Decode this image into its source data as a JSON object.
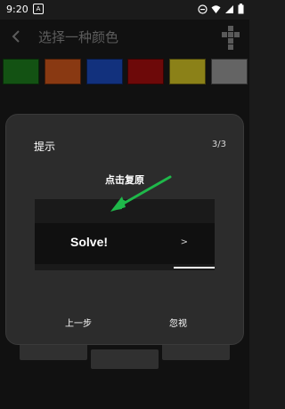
{
  "status_bar": {
    "time": "9:20",
    "notif_letter": "A"
  },
  "app_bar": {
    "title": "选择一种颜色"
  },
  "palette": {
    "colors": [
      "#1e7e1e",
      "#d3581c",
      "#1c4cc0",
      "#a80e0e",
      "#d6c626",
      "#9a9a9a"
    ]
  },
  "dialog": {
    "title": "提示",
    "counter": "3/3",
    "subtitle": "点击复原",
    "preview": {
      "button_label": "Solve!",
      "chevron": ">"
    },
    "buttons": {
      "prev": "上一步",
      "ignore": "忽视"
    }
  },
  "colors": {
    "background": "#1b1b1b",
    "dialog": "#2c2c2c",
    "arrow": "#1fb84a"
  }
}
